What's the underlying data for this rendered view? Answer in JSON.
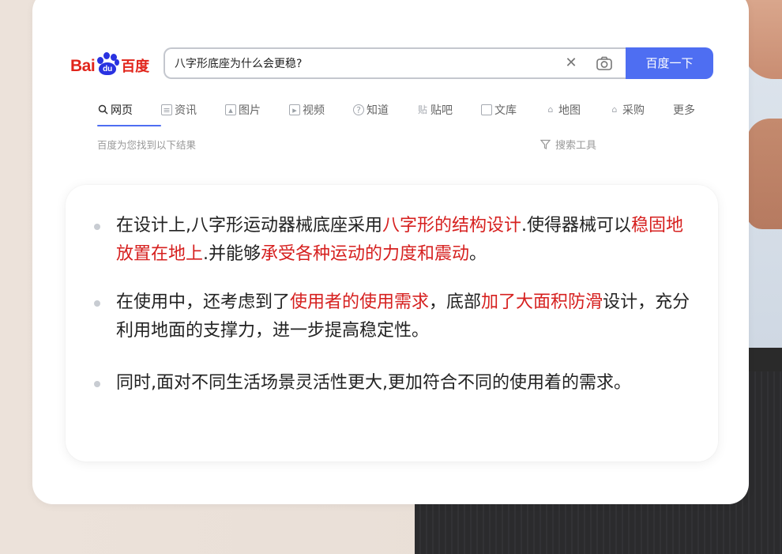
{
  "logo": {
    "bai": "Bai",
    "du": "du",
    "cn": "百度"
  },
  "search": {
    "query": "八字形底座为什么会更稳?",
    "button_label": "百度一下"
  },
  "tabs": [
    {
      "label": "网页",
      "icon": "search-icon",
      "active": true
    },
    {
      "label": "资讯",
      "icon": "news-icon"
    },
    {
      "label": "图片",
      "icon": "image-icon"
    },
    {
      "label": "视频",
      "icon": "video-icon"
    },
    {
      "label": "知道",
      "icon": "question-icon"
    },
    {
      "label": "贴吧",
      "icon": "tieba-icon"
    },
    {
      "label": "文库",
      "icon": "document-icon"
    },
    {
      "label": "地图",
      "icon": "map-icon"
    },
    {
      "label": "采购",
      "icon": "shop-icon"
    },
    {
      "label": "更多"
    }
  ],
  "results": {
    "count_text": "百度为您找到以下结果",
    "tools_label": "搜索工具"
  },
  "answer": {
    "items": [
      {
        "parts": [
          {
            "text": "在设计上,八字形运动器械底座采用"
          },
          {
            "text": "八字形的结构设计",
            "highlight": true
          },
          {
            "text": ".使得器械可以"
          },
          {
            "text": "稳固地放置在地上",
            "highlight": true
          },
          {
            "text": ".并能够"
          },
          {
            "text": "承受各种运动的力度和震动",
            "highlight": true
          },
          {
            "text": "。"
          }
        ]
      },
      {
        "parts": [
          {
            "text": "在使用中，还考虑到了"
          },
          {
            "text": "使用者的使用需求",
            "highlight": true
          },
          {
            "text": "，底部"
          },
          {
            "text": "加了大面积防滑",
            "highlight": true
          },
          {
            "text": "设计，充分利用地面的支撑力，进一步提高稳定性。"
          }
        ]
      },
      {
        "parts": [
          {
            "text": "同时,面对不同生活场景灵活性更大,更加符合不同的使用着的需求。"
          }
        ]
      }
    ]
  },
  "colors": {
    "brand_red": "#e1251b",
    "brand_blue": "#2932e1",
    "button_blue": "#4e6ef2",
    "highlight_red": "#d6201f"
  }
}
